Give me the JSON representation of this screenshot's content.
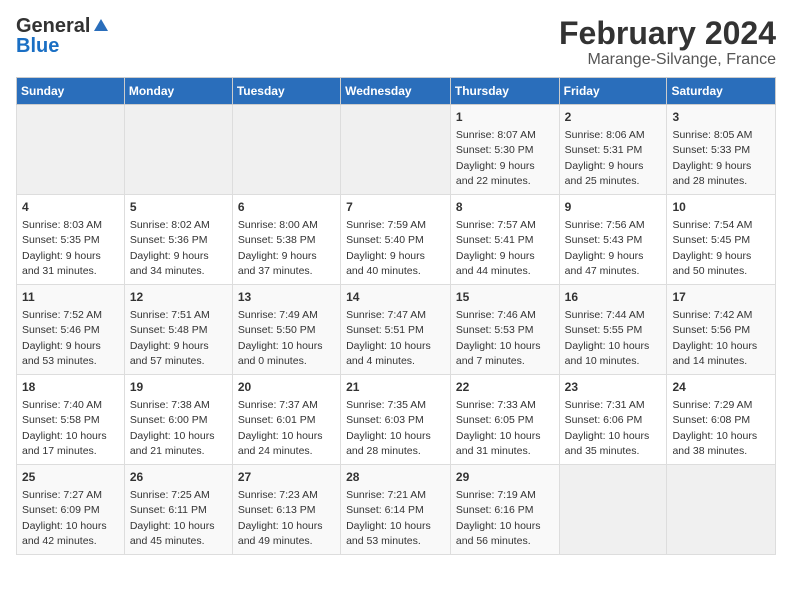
{
  "header": {
    "logo_general": "General",
    "logo_blue": "Blue",
    "title": "February 2024",
    "subtitle": "Marange-Silvange, France"
  },
  "columns": [
    "Sunday",
    "Monday",
    "Tuesday",
    "Wednesday",
    "Thursday",
    "Friday",
    "Saturday"
  ],
  "weeks": [
    [
      {
        "day": "",
        "info": ""
      },
      {
        "day": "",
        "info": ""
      },
      {
        "day": "",
        "info": ""
      },
      {
        "day": "",
        "info": ""
      },
      {
        "day": "1",
        "info": "Sunrise: 8:07 AM\nSunset: 5:30 PM\nDaylight: 9 hours\nand 22 minutes."
      },
      {
        "day": "2",
        "info": "Sunrise: 8:06 AM\nSunset: 5:31 PM\nDaylight: 9 hours\nand 25 minutes."
      },
      {
        "day": "3",
        "info": "Sunrise: 8:05 AM\nSunset: 5:33 PM\nDaylight: 9 hours\nand 28 minutes."
      }
    ],
    [
      {
        "day": "4",
        "info": "Sunrise: 8:03 AM\nSunset: 5:35 PM\nDaylight: 9 hours\nand 31 minutes."
      },
      {
        "day": "5",
        "info": "Sunrise: 8:02 AM\nSunset: 5:36 PM\nDaylight: 9 hours\nand 34 minutes."
      },
      {
        "day": "6",
        "info": "Sunrise: 8:00 AM\nSunset: 5:38 PM\nDaylight: 9 hours\nand 37 minutes."
      },
      {
        "day": "7",
        "info": "Sunrise: 7:59 AM\nSunset: 5:40 PM\nDaylight: 9 hours\nand 40 minutes."
      },
      {
        "day": "8",
        "info": "Sunrise: 7:57 AM\nSunset: 5:41 PM\nDaylight: 9 hours\nand 44 minutes."
      },
      {
        "day": "9",
        "info": "Sunrise: 7:56 AM\nSunset: 5:43 PM\nDaylight: 9 hours\nand 47 minutes."
      },
      {
        "day": "10",
        "info": "Sunrise: 7:54 AM\nSunset: 5:45 PM\nDaylight: 9 hours\nand 50 minutes."
      }
    ],
    [
      {
        "day": "11",
        "info": "Sunrise: 7:52 AM\nSunset: 5:46 PM\nDaylight: 9 hours\nand 53 minutes."
      },
      {
        "day": "12",
        "info": "Sunrise: 7:51 AM\nSunset: 5:48 PM\nDaylight: 9 hours\nand 57 minutes."
      },
      {
        "day": "13",
        "info": "Sunrise: 7:49 AM\nSunset: 5:50 PM\nDaylight: 10 hours\nand 0 minutes."
      },
      {
        "day": "14",
        "info": "Sunrise: 7:47 AM\nSunset: 5:51 PM\nDaylight: 10 hours\nand 4 minutes."
      },
      {
        "day": "15",
        "info": "Sunrise: 7:46 AM\nSunset: 5:53 PM\nDaylight: 10 hours\nand 7 minutes."
      },
      {
        "day": "16",
        "info": "Sunrise: 7:44 AM\nSunset: 5:55 PM\nDaylight: 10 hours\nand 10 minutes."
      },
      {
        "day": "17",
        "info": "Sunrise: 7:42 AM\nSunset: 5:56 PM\nDaylight: 10 hours\nand 14 minutes."
      }
    ],
    [
      {
        "day": "18",
        "info": "Sunrise: 7:40 AM\nSunset: 5:58 PM\nDaylight: 10 hours\nand 17 minutes."
      },
      {
        "day": "19",
        "info": "Sunrise: 7:38 AM\nSunset: 6:00 PM\nDaylight: 10 hours\nand 21 minutes."
      },
      {
        "day": "20",
        "info": "Sunrise: 7:37 AM\nSunset: 6:01 PM\nDaylight: 10 hours\nand 24 minutes."
      },
      {
        "day": "21",
        "info": "Sunrise: 7:35 AM\nSunset: 6:03 PM\nDaylight: 10 hours\nand 28 minutes."
      },
      {
        "day": "22",
        "info": "Sunrise: 7:33 AM\nSunset: 6:05 PM\nDaylight: 10 hours\nand 31 minutes."
      },
      {
        "day": "23",
        "info": "Sunrise: 7:31 AM\nSunset: 6:06 PM\nDaylight: 10 hours\nand 35 minutes."
      },
      {
        "day": "24",
        "info": "Sunrise: 7:29 AM\nSunset: 6:08 PM\nDaylight: 10 hours\nand 38 minutes."
      }
    ],
    [
      {
        "day": "25",
        "info": "Sunrise: 7:27 AM\nSunset: 6:09 PM\nDaylight: 10 hours\nand 42 minutes."
      },
      {
        "day": "26",
        "info": "Sunrise: 7:25 AM\nSunset: 6:11 PM\nDaylight: 10 hours\nand 45 minutes."
      },
      {
        "day": "27",
        "info": "Sunrise: 7:23 AM\nSunset: 6:13 PM\nDaylight: 10 hours\nand 49 minutes."
      },
      {
        "day": "28",
        "info": "Sunrise: 7:21 AM\nSunset: 6:14 PM\nDaylight: 10 hours\nand 53 minutes."
      },
      {
        "day": "29",
        "info": "Sunrise: 7:19 AM\nSunset: 6:16 PM\nDaylight: 10 hours\nand 56 minutes."
      },
      {
        "day": "",
        "info": ""
      },
      {
        "day": "",
        "info": ""
      }
    ]
  ]
}
